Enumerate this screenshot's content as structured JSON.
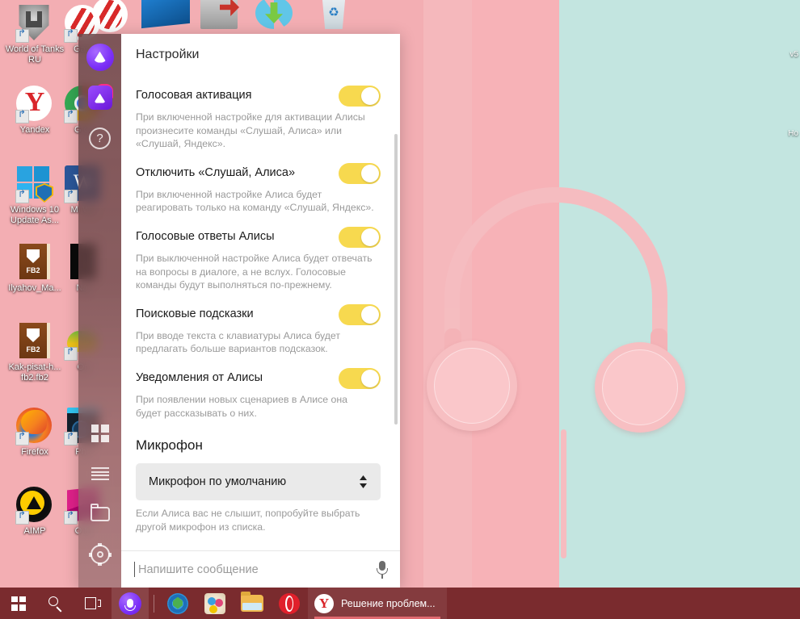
{
  "window": {
    "title": "Настройки"
  },
  "rail": {
    "items": [
      {
        "name": "alice-logo",
        "icon": "alice-circle-icon"
      },
      {
        "name": "alice-app",
        "icon": "alice-square-icon"
      },
      {
        "name": "help",
        "icon": "question-mark-icon",
        "label": "?"
      },
      {
        "name": "apps",
        "icon": "grid-icon"
      },
      {
        "name": "list",
        "icon": "list-icon"
      },
      {
        "name": "files",
        "icon": "folder-icon"
      },
      {
        "name": "settings",
        "icon": "gear-icon"
      }
    ]
  },
  "settings": {
    "items": [
      {
        "title": "Голосовая активация",
        "desc": "При включенной настройке для активации Алисы произнесите команды «Слушай, Алиса» или «Слушай, Яндекс».",
        "toggle": "on"
      },
      {
        "title": "Отключить «Слушай, Алиса»",
        "desc": "При включенной настройке Алиса будет реагировать только на команду «Слушай, Яндекс».",
        "toggle": "on"
      },
      {
        "title": "Голосовые ответы Алисы",
        "desc": "При выключенной настройке Алиса будет отвечать на вопросы в диалоге, а не вслух. Голосовые команды будут выполняться по-прежнему.",
        "toggle": "on"
      },
      {
        "title": "Поисковые подсказки",
        "desc": "При вводе текста с клавиатуры Алиса будет предлагать больше вариантов подсказок.",
        "toggle": "on"
      },
      {
        "title": "Уведомления от Алисы",
        "desc": "При появлении новых сценариев в Алисе она будет рассказывать о них.",
        "toggle": "on"
      }
    ],
    "microphone": {
      "section_title": "Микрофон",
      "selected": "Микрофон по умолчанию",
      "desc": "Если Алиса вас не слышит, попробуйте выбрать другой микрофон из списка."
    }
  },
  "message_input": {
    "placeholder": "Напишите сообщение",
    "mic_icon": "microphone-icon"
  },
  "desktop": {
    "icons_col1": [
      {
        "label": "World of Tanks RU",
        "icon": "world-of-tanks-icon"
      },
      {
        "label": "Yandex",
        "icon": "yandex-browser-icon"
      },
      {
        "label": "Windows 10 Update As...",
        "icon": "windows-update-assistant-icon"
      },
      {
        "label": "Ilyahov_Ma...",
        "icon": "fb2-book-icon"
      },
      {
        "label": "Kak-pisat-h... fb2.fb2",
        "icon": "fb2-book-icon"
      },
      {
        "label": "Firefox",
        "icon": "firefox-icon"
      },
      {
        "label": "AIMP",
        "icon": "aimp-icon"
      }
    ],
    "icons_col2": [
      {
        "label": "Gam",
        "icon": "game-icon"
      },
      {
        "label": "G Cl",
        "icon": "google-chrome-icon"
      },
      {
        "label": "Mi We",
        "icon": "microsoft-word-icon"
      },
      {
        "label": "Nat",
        "icon": "dark-file-icon"
      },
      {
        "label": "On",
        "icon": "onenote-icon"
      },
      {
        "label": "Pho",
        "icon": "photoshop-icon"
      },
      {
        "label": "O M",
        "icon": "magenta-app-icon"
      }
    ],
    "icons_top": [
      {
        "name": "game-icon"
      },
      {
        "name": "screen-icon"
      },
      {
        "name": "archive-icon"
      },
      {
        "name": "download-icon"
      },
      {
        "name": "recycle-bin-icon"
      }
    ],
    "edge_labels": [
      "v5",
      "Hо"
    ]
  },
  "taskbar": {
    "start": "start-button",
    "search": "search-icon",
    "task_view": "task-view-icon",
    "alice": "alice-taskbar-icon",
    "pinned": [
      "yandex-disk-icon",
      "paint-icon",
      "file-explorer-icon",
      "opera-icon"
    ],
    "open_window": {
      "label": "Решение проблем...",
      "icon": "yandex-browser-icon"
    }
  },
  "colors": {
    "toggle_on": "#F7D94F",
    "taskbar": "#7A2B2E",
    "wallpaper_left": "#F3AEB3",
    "wallpaper_right": "#C3E5E0",
    "accent_purple": "#7B2FF7"
  }
}
